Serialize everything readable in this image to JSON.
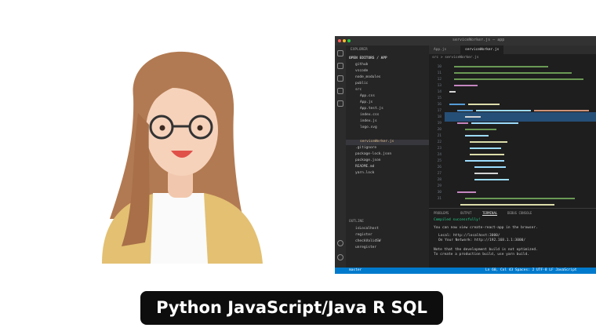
{
  "editor": {
    "title": "serviceWorker.js — app",
    "tabs": [
      "App.js",
      "serviceWorker.js"
    ],
    "breadcrumb": "src > serviceWorker.js",
    "sidebar": {
      "header": "EXPLORER",
      "project": "OPEN EDITORS / APP",
      "items": [
        "github",
        "vscode",
        "node_modules",
        "public",
        "src",
        "App.css",
        "App.js",
        "App.test.js",
        "index.css",
        "index.js",
        "logo.svg",
        "serviceWorker.js",
        ".gitignore",
        "package-lock.json",
        "package.json",
        "README.md",
        "yarn.lock"
      ],
      "outline_header": "OUTLINE",
      "outline_items": [
        "isLocalhost",
        "register",
        "checkValidSW",
        "unregister"
      ]
    },
    "panel": {
      "tabs": [
        "PROBLEMS",
        "OUTPUT",
        "TERMINAL",
        "DEBUG CONSOLE"
      ],
      "lines": [
        "Compiled successfully!",
        "You can now view create-react-app in the browser.",
        "Local:  http://localhost:3000/",
        "On Your Network:  http://192.168.1.1:3000/",
        "Note that the development build is not optimized.",
        "To create a production build, use yarn build."
      ]
    },
    "status": {
      "left": "master",
      "right": "Ln 60, Col 43   Spaces: 2   UTF-8   LF   JavaScript"
    }
  },
  "caption": "Python JavaScript/Java R SQL"
}
